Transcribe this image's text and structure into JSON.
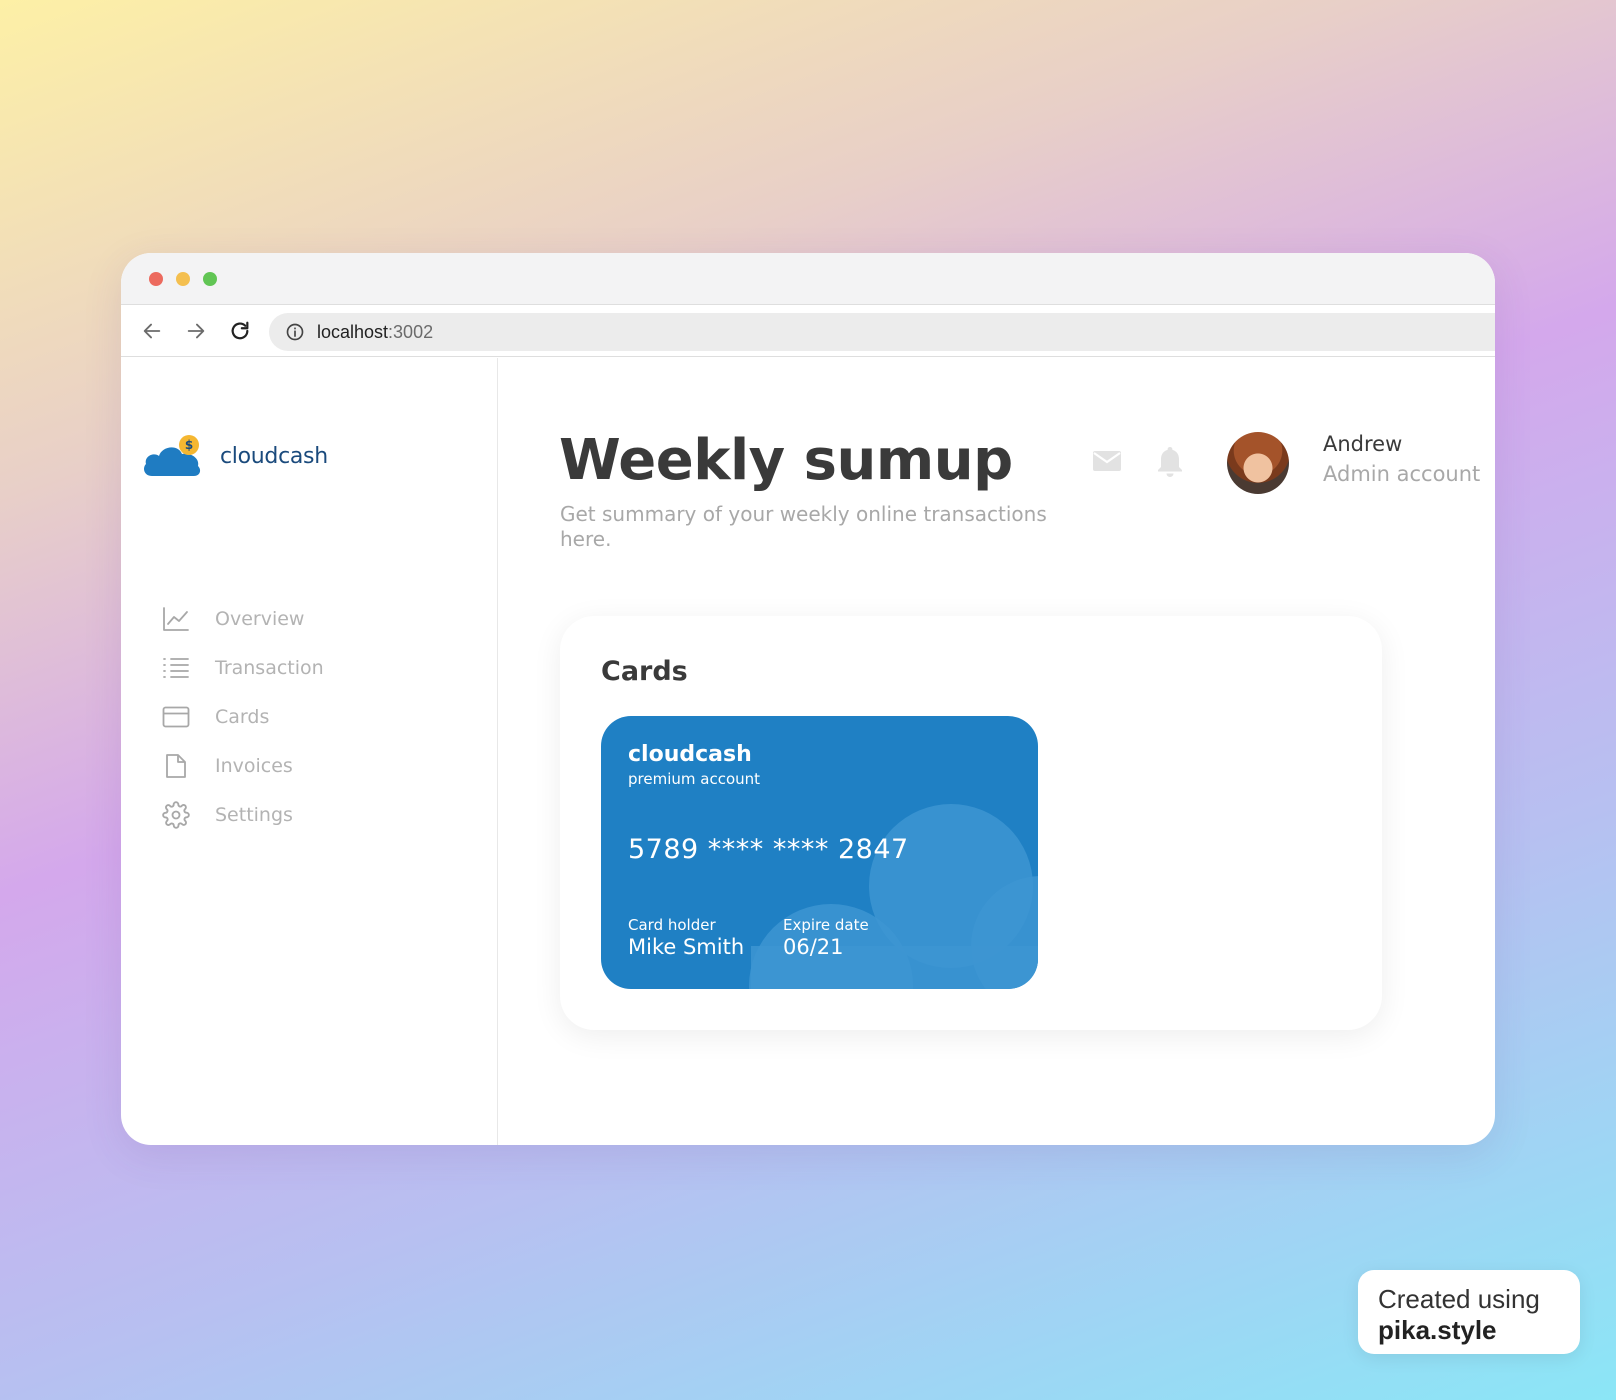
{
  "browser": {
    "url_host": "localhost",
    "url_port": ":3002"
  },
  "sidebar": {
    "brand": "cloudcash",
    "items": [
      {
        "label": "Overview",
        "icon": "chart-line-icon"
      },
      {
        "label": "Transaction",
        "icon": "list-icon"
      },
      {
        "label": "Cards",
        "icon": "credit-card-icon"
      },
      {
        "label": "Invoices",
        "icon": "document-icon"
      },
      {
        "label": "Settings",
        "icon": "gear-icon"
      }
    ]
  },
  "header": {
    "title": "Weekly sumup",
    "subtitle": "Get summary of your weekly online transactions here.",
    "user_name": "Andrew",
    "user_role": "Admin account"
  },
  "cards_panel": {
    "title": "Cards",
    "card": {
      "brand": "cloudcash",
      "tier": "premium account",
      "number": "5789 **** **** 2847",
      "holder_label": "Card holder",
      "holder": "Mike Smith",
      "expire_label": "Expire date",
      "expire": "06/21"
    }
  },
  "watermark": {
    "line1": "Created using",
    "line2": "pika.style"
  },
  "colors": {
    "card_blue": "#1f80c4",
    "brand_text": "#1a4a7c",
    "logo_yellow": "#f5b731"
  }
}
